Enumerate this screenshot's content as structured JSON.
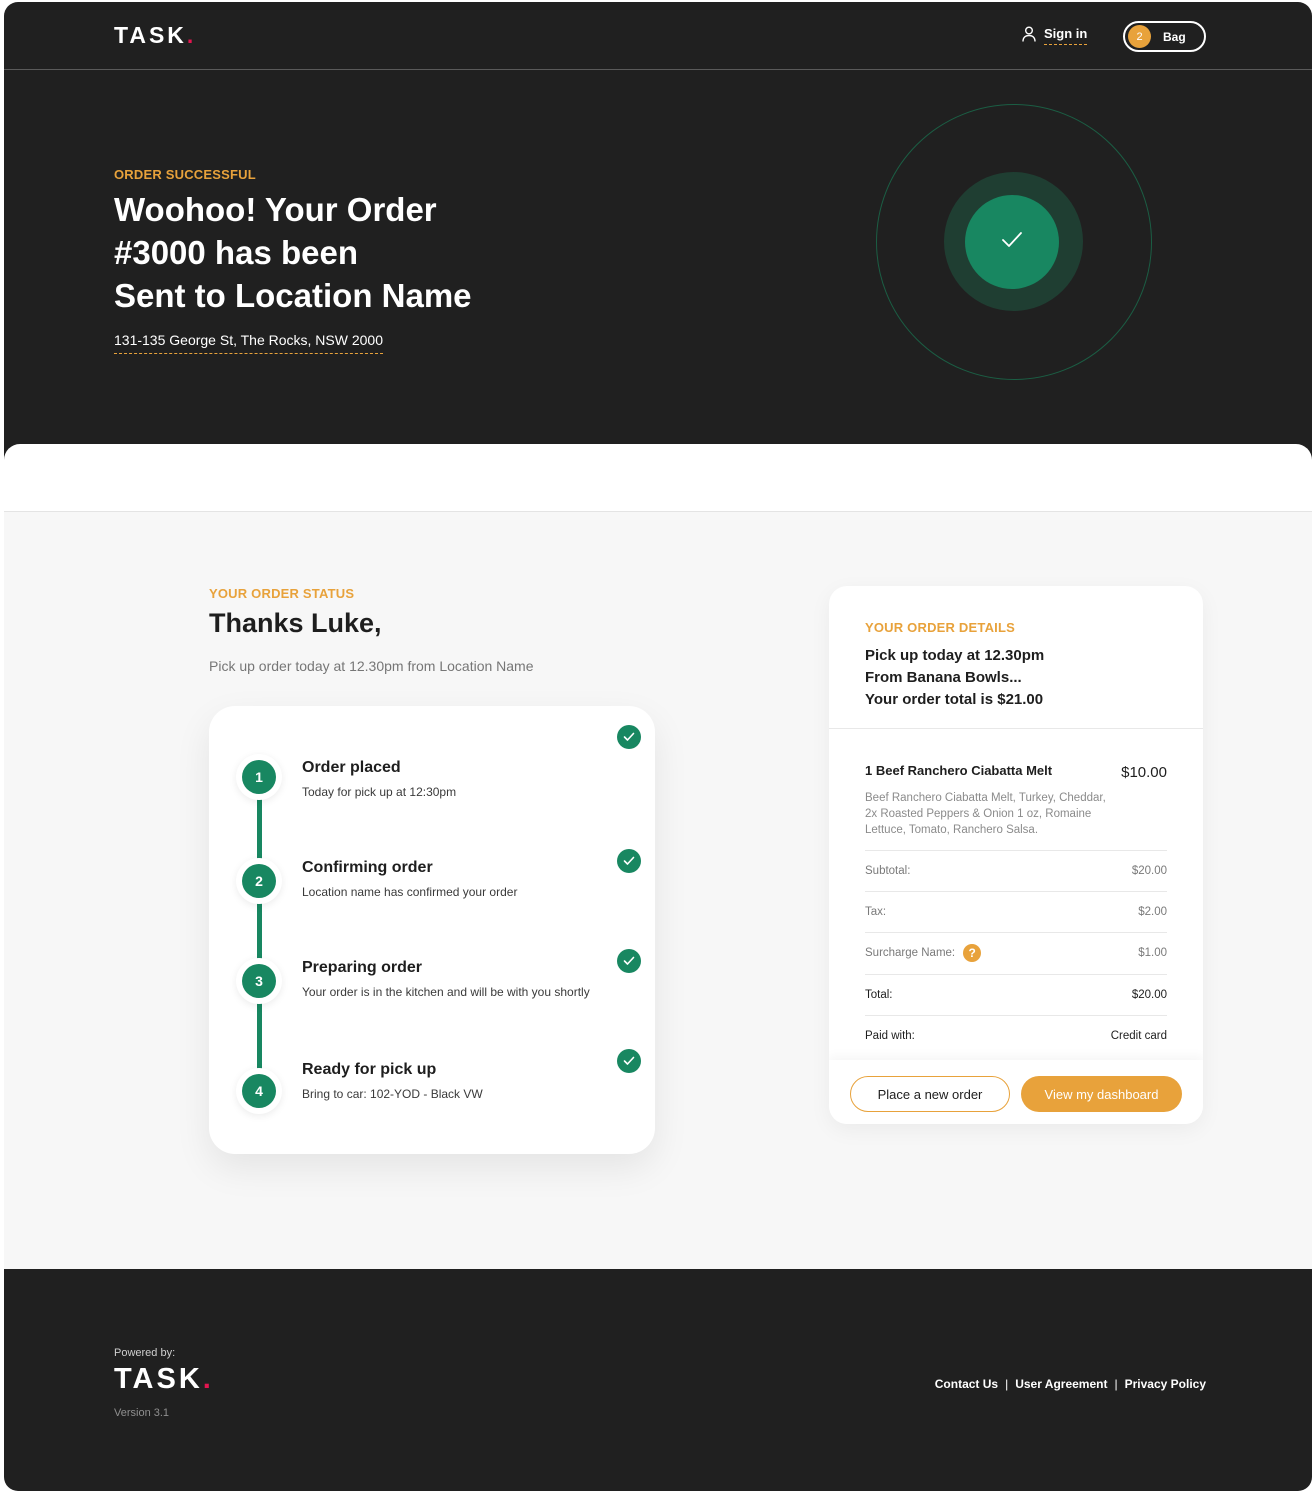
{
  "header": {
    "logo": "TASK",
    "logo_dot": ".",
    "sign_in": "Sign in",
    "bag_count": "2",
    "bag_label": "Bag"
  },
  "hero": {
    "eyebrow": "ORDER SUCCESSFUL",
    "title_line1": "Woohoo! Your Order",
    "title_line2": "#3000 has been",
    "title_line3": "Sent to Location Name",
    "address": "131-135 George St, The Rocks, NSW 2000",
    "icon": "check-icon"
  },
  "status": {
    "eyebrow": "YOUR ORDER STATUS",
    "greeting": "Thanks Luke,",
    "pickup_line": "Pick up order today at 12.30pm from Location Name",
    "steps": [
      {
        "number": "1",
        "title": "Order placed",
        "desc": "Today for pick up at 12:30pm",
        "done": true
      },
      {
        "number": "2",
        "title": "Confirming order",
        "desc": "Location name has confirmed your order",
        "done": true
      },
      {
        "number": "3",
        "title": "Preparing order",
        "desc": "Your order is in the kitchen and will be with you shortly",
        "done": true
      },
      {
        "number": "4",
        "title": "Ready for pick up",
        "desc": "Bring to car: 102-YOD - Black VW",
        "done": true
      }
    ]
  },
  "details": {
    "eyebrow": "YOUR ORDER DETAILS",
    "summary_line1": "Pick up today at 12.30pm",
    "summary_line2": "From Banana Bowls...",
    "summary_line3": "Your order total is $21.00",
    "item": {
      "name": "1 Beef Ranchero Ciabatta Melt",
      "price": "$10.00",
      "desc": "Beef Ranchero Ciabatta Melt, Turkey, Cheddar, 2x Roasted Peppers & Onion 1 oz, Romaine Lettuce, Tomato, Ranchero Salsa."
    },
    "rows": [
      {
        "label": "Subtotal:",
        "value": "$20.00"
      },
      {
        "label": "Tax:",
        "value": "$2.00"
      },
      {
        "label": "Surcharge Name:",
        "value": "$1.00",
        "help": "?"
      },
      {
        "label": "Total:",
        "value": "$20.00"
      },
      {
        "label": "Paid with:",
        "value": "Credit card"
      }
    ],
    "btn_new_order": "Place a new order",
    "btn_dashboard": "View my dashboard"
  },
  "footer": {
    "powered_by": "Powered by:",
    "logo": "TASK",
    "logo_dot": ".",
    "version": "Version 3.1",
    "links": [
      "Contact Us",
      "User Agreement",
      "Privacy Policy"
    ],
    "separator": "|"
  },
  "colors": {
    "accent": "#e8a23b",
    "success": "#188761",
    "brand_dot": "#e3154f",
    "dark": "#202020"
  }
}
